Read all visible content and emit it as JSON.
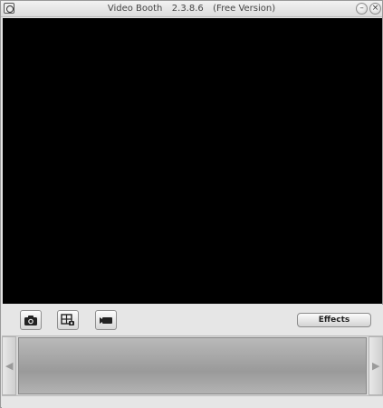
{
  "window": {
    "title_app": "Video Booth",
    "title_version": "2.3.8.6",
    "title_edition": "(Free Version)",
    "minimize_glyph": "–",
    "close_glyph": "×"
  },
  "toolbar": {
    "photo_icon": "camera-icon",
    "grid_icon": "photo-grid-icon",
    "video_icon": "video-camera-icon",
    "effects_label": "Effects"
  },
  "strip": {
    "left_arrow": "◀",
    "right_arrow": "▶"
  }
}
